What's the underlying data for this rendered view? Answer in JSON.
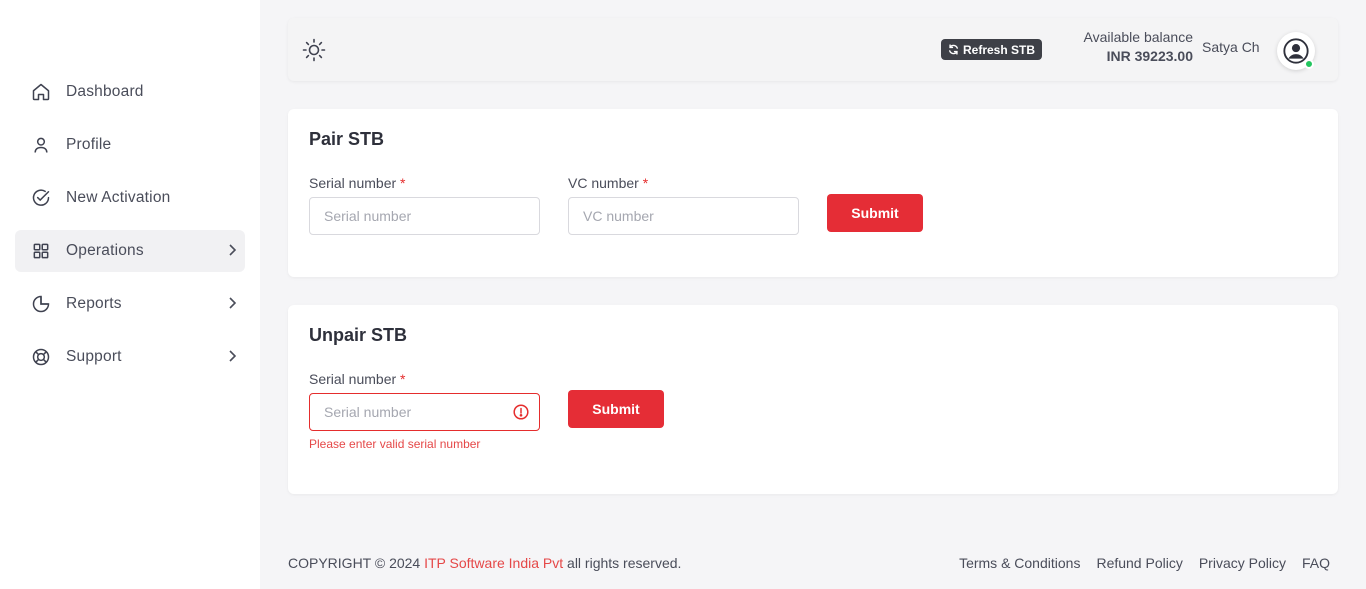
{
  "sidebar": {
    "items": [
      {
        "label": "Dashboard",
        "icon": "home-icon"
      },
      {
        "label": "Profile",
        "icon": "user-icon"
      },
      {
        "label": "New Activation",
        "icon": "check-circle-icon"
      },
      {
        "label": "Operations",
        "icon": "grid-icon",
        "active": true,
        "has_submenu": true
      },
      {
        "label": "Reports",
        "icon": "pie-chart-icon",
        "has_submenu": true
      },
      {
        "label": "Support",
        "icon": "lifebuoy-icon",
        "has_submenu": true
      }
    ]
  },
  "header": {
    "refresh_label": "Refresh STB",
    "balance_label": "Available balance",
    "balance_value": "INR 39223.00",
    "username": "Satya Ch",
    "status_color": "#22c55e"
  },
  "pair_stb": {
    "title": "Pair STB",
    "serial_label": "Serial number",
    "serial_placeholder": "Serial number",
    "vc_label": "VC number",
    "vc_placeholder": "VC number",
    "required_mark": "*",
    "submit_label": "Submit"
  },
  "unpair_stb": {
    "title": "Unpair STB",
    "serial_label": "Serial number",
    "serial_placeholder": "Serial number",
    "required_mark": "*",
    "error_text": "Please enter valid serial number",
    "submit_label": "Submit"
  },
  "footer": {
    "copyright_prefix": "COPYRIGHT © 2024 ",
    "company": "ITP Software India Pvt",
    "copyright_suffix": " all rights reserved.",
    "links": [
      "Terms & Conditions",
      "Refund Policy",
      "Privacy Policy",
      "FAQ"
    ]
  },
  "colors": {
    "accent": "#e52d36",
    "error": "#e54848"
  }
}
